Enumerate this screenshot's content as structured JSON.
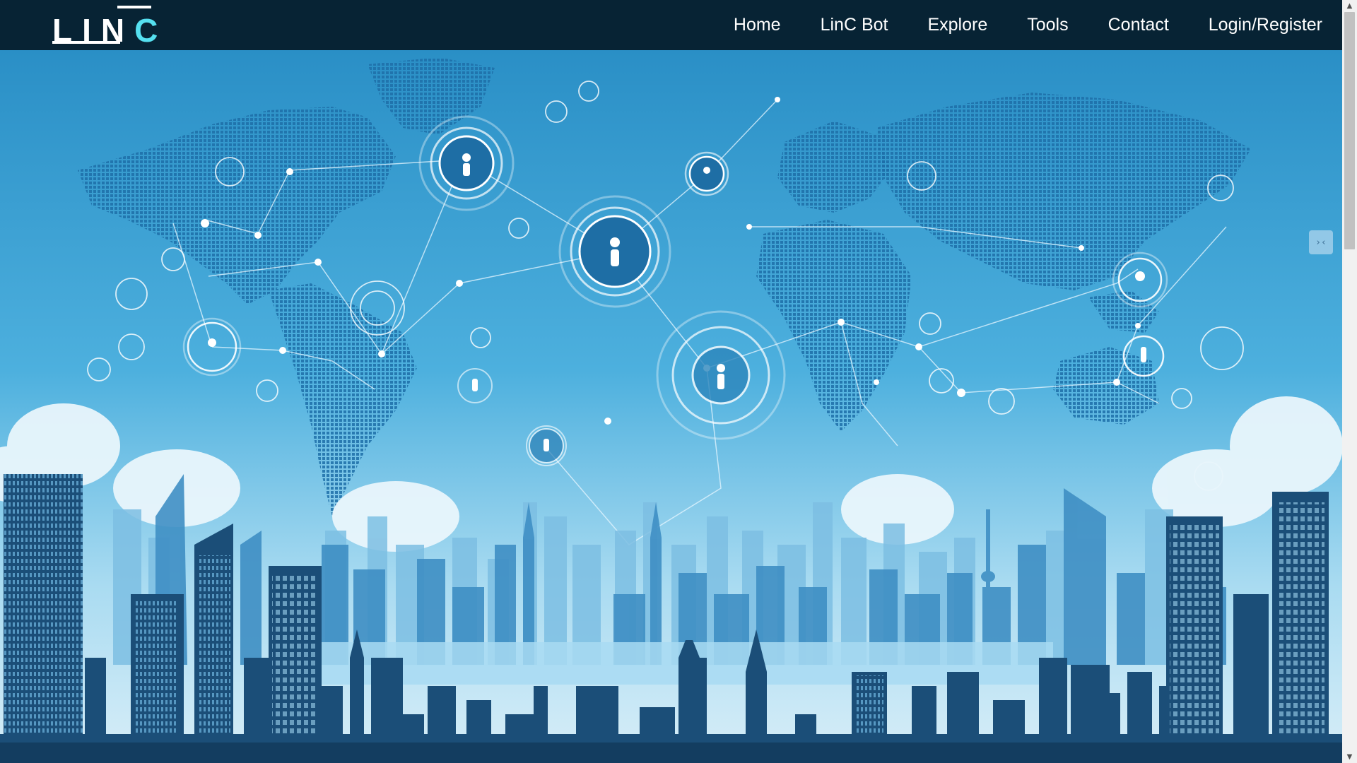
{
  "brand": {
    "logo_main": "LIN",
    "logo_accent": "C"
  },
  "nav": {
    "items": [
      {
        "label": "Home"
      },
      {
        "label": "LinC Bot"
      },
      {
        "label": "Explore"
      },
      {
        "label": "Tools"
      },
      {
        "label": "Contact"
      },
      {
        "label": "Login/Register"
      }
    ]
  },
  "hero": {
    "image": "world-network-city-skyline-illustration"
  },
  "widgets": {
    "side_toggle_icon": "code-collapse-icon",
    "side_toggle_glyph": "›‹"
  },
  "scrollbar": {
    "up_glyph": "▲",
    "down_glyph": "▼",
    "position_fraction": 0.0
  },
  "colors": {
    "nav_bg": "#072334",
    "logo_accent": "#55e0f0",
    "sky_top": "#2a8fc6",
    "sky_bottom": "#d8eef8",
    "city_dark": "#1b4e78"
  }
}
